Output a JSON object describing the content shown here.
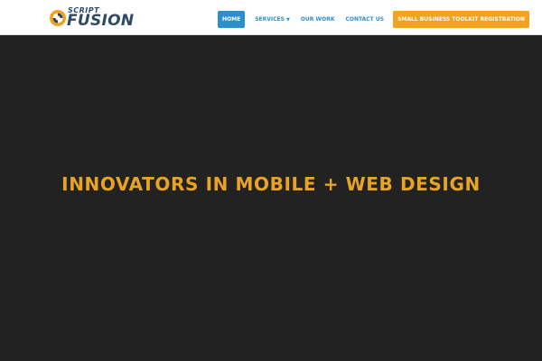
{
  "brand": {
    "logo_line1": "SCRIPT",
    "logo_line2": "FUSION",
    "logo_accent_color": "#f4a21d",
    "logo_text_color": "#2c4a63"
  },
  "nav": {
    "items": [
      {
        "label": "HOME",
        "active": true
      },
      {
        "label": "SERVICES",
        "has_dropdown": true,
        "icon": "caret-down-icon"
      },
      {
        "label": "OUR WORK"
      },
      {
        "label": "CONTACT US"
      }
    ],
    "cta_label": "SMALL BUSINESS TOOLKIT REGISTRATION",
    "accent_color": "#2d8fc9",
    "cta_color": "#f4a21d"
  },
  "hero": {
    "title": "INNOVATORS IN MOBILE + WEB DESIGN",
    "title_color": "#e8a325",
    "background_color": "#222222"
  }
}
